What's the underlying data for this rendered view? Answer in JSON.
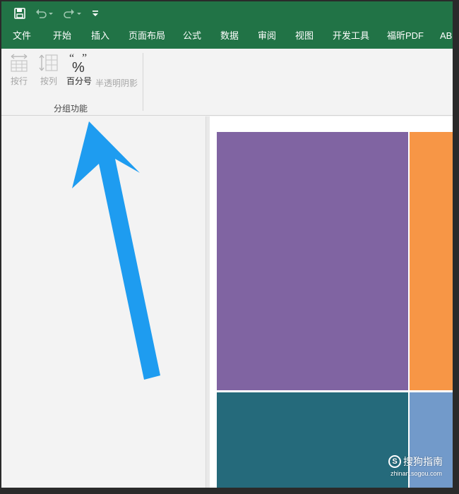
{
  "quick_access": {
    "save_icon": "save-icon",
    "undo_icon": "undo-icon",
    "redo_icon": "redo-icon",
    "customize_icon": "customize-arrow-icon"
  },
  "menu_tabs": [
    {
      "label": "文件"
    },
    {
      "label": "开始"
    },
    {
      "label": "插入"
    },
    {
      "label": "页面布局"
    },
    {
      "label": "公式"
    },
    {
      "label": "数据"
    },
    {
      "label": "审阅"
    },
    {
      "label": "视图"
    },
    {
      "label": "开发工具"
    },
    {
      "label": "福昕PDF"
    },
    {
      "label": "ABB"
    }
  ],
  "ribbon": {
    "buttons": [
      {
        "label": "按行",
        "icon": "by-row-icon",
        "enabled": false
      },
      {
        "label": "按列",
        "icon": "by-column-icon",
        "enabled": false
      },
      {
        "label": "百分号",
        "icon": "percent-icon",
        "enabled": true,
        "glyph": "%"
      },
      {
        "label": "半透明阴影",
        "enabled": false
      }
    ],
    "group_label": "分组功能"
  },
  "treemap": {
    "tiles": [
      {
        "color": "#8064a2"
      },
      {
        "color": "#f79646"
      },
      {
        "color": "#256a7b"
      },
      {
        "color": "#729aca"
      }
    ]
  },
  "annotation": {
    "arrow_color": "#1e9cf0"
  },
  "watermark": {
    "text": "搜狗指南",
    "sub": "zhinan.sogou.com"
  },
  "colors": {
    "titlebar": "#217346",
    "ribbon_bg": "#f3f3f3"
  }
}
